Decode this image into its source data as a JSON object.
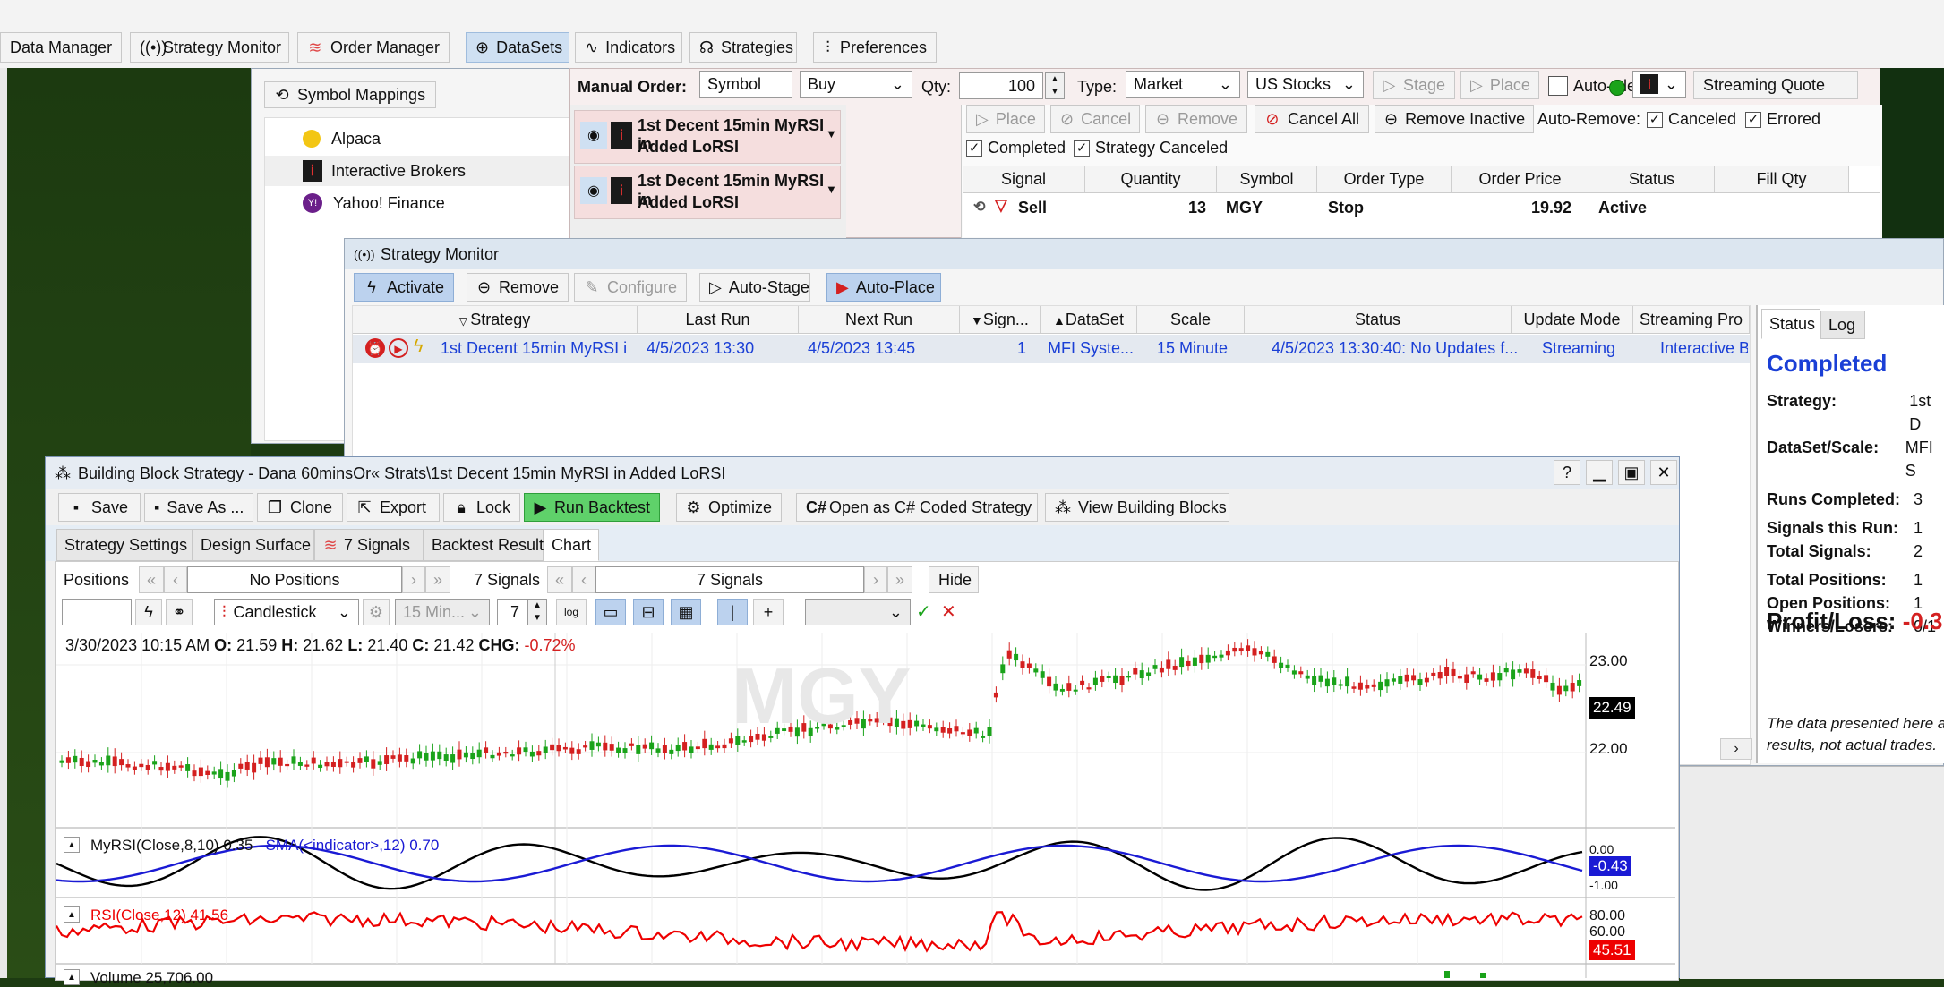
{
  "main_toolbar": {
    "data_manager": "Data Manager",
    "strategy_monitor": "Strategy Monitor",
    "order_manager": "Order Manager",
    "datasets": "DataSets",
    "indicators": "Indicators",
    "strategies": "Strategies",
    "preferences": "Preferences"
  },
  "data_manager": {
    "symbol_mappings": "Symbol Mappings",
    "providers": [
      {
        "label": "Alpaca"
      },
      {
        "label": "Interactive Brokers"
      },
      {
        "label": "Yahoo! Finance"
      }
    ]
  },
  "order_manager": {
    "manual_order_label": "Manual Order:",
    "symbol_placeholder": "Symbol",
    "side": "Buy",
    "qty_label": "Qty:",
    "qty": "100",
    "type_label": "Type:",
    "type": "Market",
    "market": "US Stocks",
    "stage": "Stage",
    "place": "Place",
    "auto_clear": "Auto-Clear",
    "streaming_quote": "Streaming Quote",
    "strategy_rows": [
      {
        "line1": "1st Decent 15min MyRSI in",
        "line2": "Added LoRSI"
      },
      {
        "line1": "1st Decent 15min MyRSI in",
        "line2": "Added LoRSI"
      }
    ],
    "place2": "Place",
    "cancel": "Cancel",
    "remove": "Remove",
    "cancel_all": "Cancel All",
    "remove_inactive": "Remove Inactive",
    "auto_remove": "Auto-Remove:",
    "canceled": "Canceled",
    "errored": "Errored",
    "completed": "Completed",
    "strategy_canceled": "Strategy Canceled",
    "columns": [
      "Signal",
      "Quantity",
      "Symbol",
      "Order Type",
      "Order Price",
      "Status",
      "Fill Qty"
    ],
    "orders": [
      {
        "signal": "Sell",
        "quantity": "13",
        "symbol": "MGY",
        "order_type": "Stop",
        "order_price": "19.92",
        "status": "Active",
        "fill_qty": ""
      }
    ]
  },
  "strategy_monitor": {
    "title": "Strategy Monitor",
    "activate": "Activate",
    "remove": "Remove",
    "configure": "Configure",
    "auto_stage": "Auto-Stage",
    "auto_place": "Auto-Place",
    "columns": [
      "Strategy",
      "Last Run",
      "Next Run",
      "Sign...",
      "DataSet",
      "Scale",
      "Status",
      "Update Mode",
      "Streaming Pro"
    ],
    "rows": [
      {
        "strategy": "1st Decent 15min MyRSI i",
        "last_run": "4/5/2023 13:30",
        "next_run": "4/5/2023 13:45",
        "signals": "1",
        "dataset": "MFI Syste...",
        "scale": "15 Minute",
        "status": "4/5/2023 13:30:40: No Updates f...",
        "update_mode": "Streaming",
        "streaming": "Interactive Br"
      }
    ],
    "tabs": [
      "Status",
      "Log"
    ],
    "status_heading": "Completed",
    "stats": [
      {
        "k": "Strategy:",
        "v": "1st D"
      },
      {
        "k": "DataSet/Scale:",
        "v": "MFI S"
      },
      {
        "k": "Runs Completed:",
        "v": "3"
      },
      {
        "k": "Signals this Run:",
        "v": "1"
      },
      {
        "k": "Total Signals:",
        "v": "2"
      },
      {
        "k": "Total Positions:",
        "v": "1"
      },
      {
        "k": "Open Positions:",
        "v": "1"
      },
      {
        "k": "Winners/Losers:",
        "v": "0/1"
      }
    ],
    "profit_loss_label": "Profit/Loss:",
    "profit_loss_value": "-0.3",
    "disclaimer_1": "The data presented here a",
    "disclaimer_2": "results, not actual trades."
  },
  "bbs": {
    "title": "Building Block Strategy - Dana 60minsOr« Strats\\1st Decent 15min MyRSI in Added LoRSI",
    "help": "?",
    "toolbar": {
      "save": "Save",
      "save_as": "Save As ...",
      "clone": "Clone",
      "export": "Export",
      "lock": "Lock",
      "run_backtest": "Run Backtest",
      "optimize": "Optimize",
      "open_csharp": "Open as C# Coded Strategy",
      "view_blocks": "View Building Blocks"
    },
    "tabs": [
      "Strategy Settings",
      "Design Surface",
      "7 Signals",
      "Backtest Results",
      "Chart"
    ],
    "positions_label": "Positions",
    "positions_value": "No Positions",
    "signals_label": "7 Signals",
    "signals_value": "7 Signals",
    "hide": "Hide",
    "chart_style": "Candlestick",
    "scale": "15 Min...",
    "bars": "7",
    "log": "log"
  },
  "chart": {
    "info_date": "3/30/2023 10:15 AM",
    "o_label": "O:",
    "o": "21.59",
    "h_label": "H:",
    "h": "21.62",
    "l_label": "L:",
    "l": "21.40",
    "c_label": "C:",
    "c": "21.42",
    "chg_label": "CHG:",
    "chg": "-0.72%",
    "watermark": "MGY",
    "y_tick_high": "23.00",
    "y_tick_low": "22.00",
    "last_price": "22.49",
    "ind1_label": "MyRSI(Close,8,10) 0.35",
    "ind1_sma": "SMA(<indicator>,12) 0.70",
    "ind1_tick_top": "0.00",
    "ind1_tick_bottom": "-1.00",
    "ind1_value": "-0.43",
    "ind2_label": "RSI(Close,12) 41.56",
    "ind2_tick_top": "80.00",
    "ind2_tick_mid": "60.00",
    "ind2_value": "45.51",
    "volume_label": "Volume 25,706.00"
  },
  "colors": {
    "up": "#1aa31a",
    "down": "#d42020",
    "myrsi": "#000000",
    "sma": "#1a1ad4",
    "rsi": "#ee0000",
    "accent": "#1a3fd6"
  }
}
